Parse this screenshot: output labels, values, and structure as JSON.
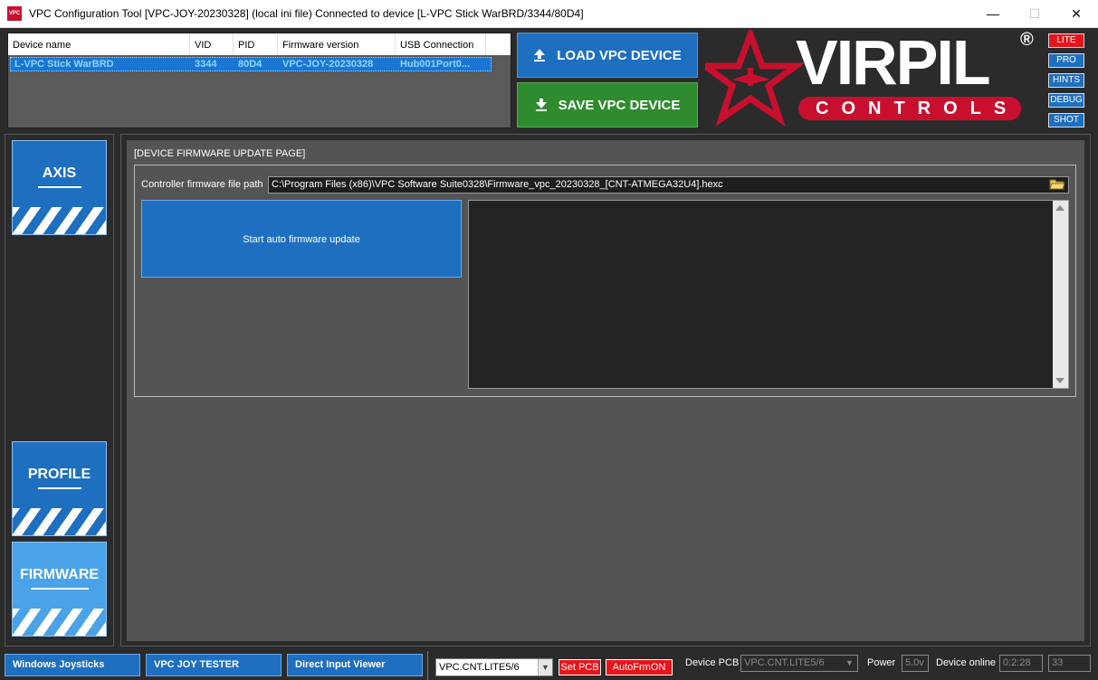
{
  "window": {
    "title": "VPC Configuration Tool [VPC-JOY-20230328] (local ini file) Connected to device [L-VPC Stick WarBRD/3344/80D4]",
    "app_icon_text": "VPC",
    "minimize_glyph": "—",
    "maximize_glyph": "☐",
    "close_glyph": "✕"
  },
  "device_list": {
    "columns": [
      "Device name",
      "VID",
      "PID",
      "Firmware version",
      "USB Connection"
    ],
    "rows": [
      [
        "L-VPC Stick WarBRD",
        "3344",
        "80D4",
        "VPC-JOY-20230328",
        "Hub001Port0..."
      ]
    ]
  },
  "actions": {
    "load_label": "LOAD VPC DEVICE",
    "save_label": "SAVE VPC DEVICE"
  },
  "logo": {
    "brand": "VIRPIL",
    "sub": "CONTROLS",
    "registered": "®",
    "brand_color": "#c8102e"
  },
  "side_buttons": {
    "lite": "LITE",
    "pro": "PRO",
    "hints": "HINTS",
    "debug": "DEBUG",
    "shot": "SHOT"
  },
  "nav": {
    "axis": "AXIS",
    "profile": "PROFILE",
    "firmware": "FIRMWARE"
  },
  "firmware_page": {
    "title": "[DEVICE FIRMWARE UPDATE PAGE]",
    "path_label": "Controller firmware file path",
    "path_value": "C:\\Program Files (x86)\\VPC Software Suite0328\\Firmware_vpc_20230328_[CNT-ATMEGA32U4].hexc",
    "start_button": "Start auto firmware update",
    "log_text": ""
  },
  "bottom": {
    "windows_joysticks": "Windows Joysticks",
    "joy_tester": "VPC JOY TESTER",
    "direct_input": "Direct Input Viewer",
    "pcb_select_value": "VPC.CNT.LITE5/6",
    "set_pcb": "Set PCB",
    "auto_frm": "AutoFrmON",
    "device_pcb_label": "Device PCB",
    "device_pcb_value": "VPC.CNT.LITE5/6",
    "power_label": "Power",
    "power_value": "5.0v",
    "online_label": "Device online",
    "online_value": "0:2:28",
    "counter_value": "33"
  }
}
